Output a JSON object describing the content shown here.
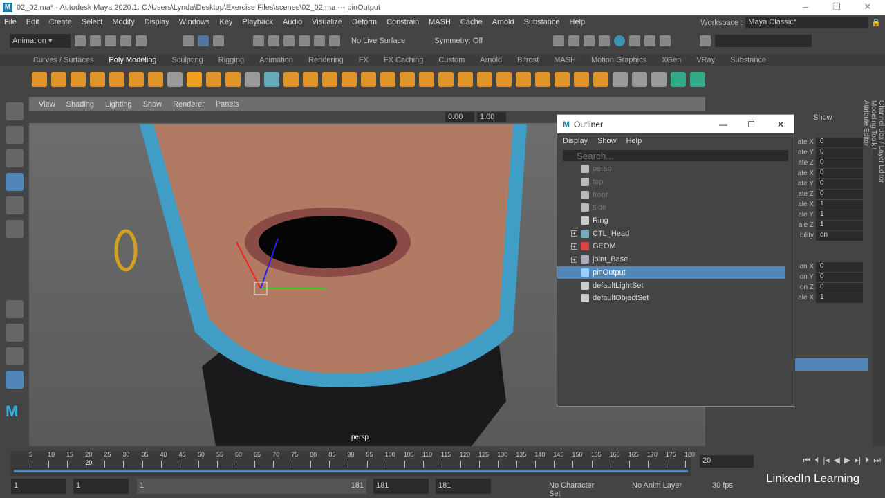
{
  "title": "02_02.ma* - Autodesk Maya 2020.1: C:\\Users\\Lynda\\Desktop\\Exercise Files\\scenes\\02_02.ma   ---   pinOutput",
  "menus": [
    "File",
    "Edit",
    "Create",
    "Select",
    "Modify",
    "Display",
    "Windows",
    "Key",
    "Playback",
    "Audio",
    "Visualize",
    "Deform",
    "Constrain",
    "MASH",
    "Cache",
    "Arnold",
    "Substance",
    "Help"
  ],
  "workspace": {
    "label": "Workspace :",
    "value": "Maya Classic*"
  },
  "status": {
    "menuset": "Animation",
    "live_surface": "No Live Surface",
    "symmetry": "Symmetry: Off"
  },
  "shelf_tabs": [
    "Curves / Surfaces",
    "Poly Modeling",
    "Sculpting",
    "Rigging",
    "Animation",
    "Rendering",
    "FX",
    "FX Caching",
    "Custom",
    "Arnold",
    "Bifrost",
    "MASH",
    "Motion Graphics",
    "XGen",
    "VRay",
    "Substance"
  ],
  "active_shelf": "Poly Modeling",
  "viewport": {
    "menus": [
      "View",
      "Shading",
      "Lighting",
      "Show",
      "Renderer",
      "Panels"
    ],
    "near": "0.00",
    "far": "1.00",
    "camera": "persp"
  },
  "outliner": {
    "title": "Outliner",
    "menus": [
      "Display",
      "Show",
      "Help"
    ],
    "search_placeholder": "Search...",
    "items": [
      {
        "name": "persp",
        "type": "camera",
        "dim": true
      },
      {
        "name": "top",
        "type": "camera",
        "dim": true
      },
      {
        "name": "front",
        "type": "camera",
        "dim": true
      },
      {
        "name": "side",
        "type": "camera",
        "dim": true
      },
      {
        "name": "Ring",
        "type": "mesh"
      },
      {
        "name": "CTL_Head",
        "type": "curve",
        "expandable": true
      },
      {
        "name": "GEOM",
        "type": "group",
        "expandable": true
      },
      {
        "name": "joint_Base",
        "type": "joint",
        "expandable": true
      },
      {
        "name": "pinOutput",
        "type": "locator",
        "selected": true
      },
      {
        "name": "defaultLightSet",
        "type": "set"
      },
      {
        "name": "defaultObjectSet",
        "type": "set"
      }
    ]
  },
  "channel_box": {
    "show": "Show",
    "channels": [
      {
        "label": "ate X",
        "value": "0"
      },
      {
        "label": "ate Y",
        "value": "0"
      },
      {
        "label": "ate Z",
        "value": "0"
      },
      {
        "label": "ate X",
        "value": "0"
      },
      {
        "label": "ate Y",
        "value": "0"
      },
      {
        "label": "ate Z",
        "value": "0"
      },
      {
        "label": "ale X",
        "value": "1"
      },
      {
        "label": "ale Y",
        "value": "1"
      },
      {
        "label": "ale Z",
        "value": "1"
      },
      {
        "label": "bility",
        "value": "on"
      }
    ],
    "shape_channels": [
      {
        "label": "on X",
        "value": "0"
      },
      {
        "label": "on Y",
        "value": "0"
      },
      {
        "label": "on Z",
        "value": "0"
      },
      {
        "label": "ale X",
        "value": "1"
      }
    ]
  },
  "side_tabs": [
    "Channel Box / Layer Editor",
    "Modeling Toolkit",
    "Attribute Editor"
  ],
  "timeline": {
    "ticks": [
      "5",
      "10",
      "15",
      "20",
      "25",
      "30",
      "35",
      "40",
      "45",
      "50",
      "55",
      "60",
      "65",
      "70",
      "75",
      "80",
      "85",
      "90",
      "95",
      "100",
      "105",
      "110",
      "115",
      "120",
      "125",
      "130",
      "135",
      "140",
      "145",
      "150",
      "155",
      "160",
      "165",
      "170",
      "175",
      "180"
    ],
    "current_frame": "20",
    "current_field": "20"
  },
  "range": {
    "start": "1",
    "playback_start": "1",
    "slider_start": "1",
    "slider_end": "181",
    "playback_end": "181",
    "end": "181",
    "character_set": "No Character Set",
    "anim_layer": "No Anim Layer",
    "fps": "30 fps"
  },
  "watermark": "LinkedIn Learning",
  "colors": {
    "selection": "#5285b8",
    "accent": "#1b7fa8"
  }
}
